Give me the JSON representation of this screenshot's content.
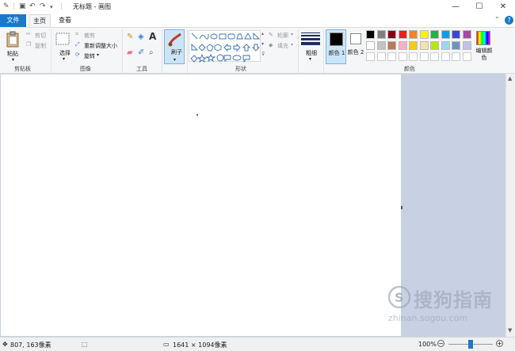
{
  "window": {
    "title": "无标题 - 画图",
    "minimize_icon": "minimize-icon",
    "maximize_icon": "maximize-icon",
    "close_icon": "close-icon"
  },
  "tabs": [
    {
      "label": "文件"
    },
    {
      "label": "主页"
    },
    {
      "label": "查看"
    }
  ],
  "ribbon": {
    "clipboard": {
      "label": "剪贴板",
      "paste": "粘贴",
      "cut": "剪切",
      "copy": "复制"
    },
    "image": {
      "label": "图像",
      "select": "选择",
      "crop": "裁剪",
      "resize": "重新调整大小",
      "rotate": "旋转"
    },
    "tools": {
      "label": "工具"
    },
    "brushes": {
      "label": "刷子"
    },
    "shapes": {
      "label": "形状",
      "outline": "轮廓",
      "fill": "填充"
    },
    "size": {
      "label": "粗细"
    },
    "color1": {
      "label": "颜色 1",
      "value": "#000000"
    },
    "color2": {
      "label": "颜色 2",
      "value": "#ffffff"
    },
    "colors": {
      "label": "颜色",
      "edit": "编辑颜色",
      "row1": [
        "#000000",
        "#7f7f7f",
        "#880015",
        "#ed1c24",
        "#ff7f27",
        "#fff200",
        "#22b14c",
        "#00a2e8",
        "#3f48cc",
        "#a349a4"
      ],
      "row2": [
        "#ffffff",
        "#c3c3c3",
        "#b97a57",
        "#ffaec9",
        "#ffc90e",
        "#efe4b0",
        "#b5e61d",
        "#99d9ea",
        "#7092be",
        "#c8bfe7"
      ]
    }
  },
  "status": {
    "cursor_pos": "807, 163像素",
    "canvas_size": "1641 × 1094像素",
    "zoom": "100%",
    "zoom_fraction": 0.5
  },
  "watermark": {
    "cn": "搜狗指南",
    "en": "zhinan.sogou.com"
  }
}
